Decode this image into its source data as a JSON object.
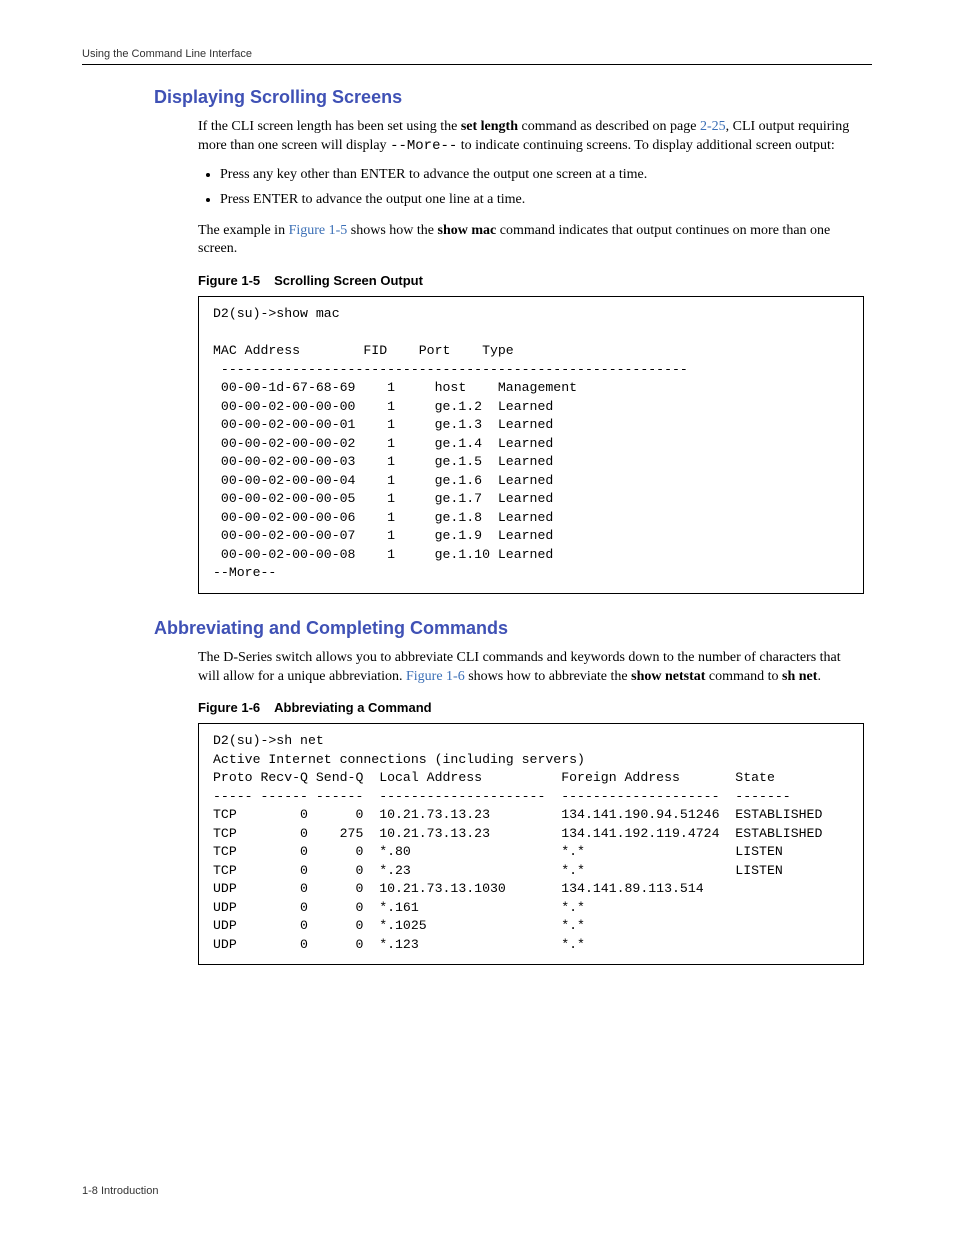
{
  "running_head": "Using the Command Line Interface",
  "footer": "1-8   Introduction",
  "section1": {
    "title": "Displaying Scrolling Screens",
    "para1_pre": "If the CLI screen length has been set using the ",
    "set_length": "set length",
    "para1_mid": " command as described on page ",
    "xref1": "2-25",
    "para1_post": ", CLI output requiring more than one screen will display ",
    "more_inline": "--More--",
    "para1_tail": " to indicate continuing screens. To display additional screen output:",
    "bullets": [
      "Press any key other than ENTER to advance the output one screen at a time.",
      "Press ENTER to advance the output one line at a time."
    ],
    "para2_pre": "The example in ",
    "xref2": "Figure 1-5",
    "para2_mid": " shows how the ",
    "show_mac": "show mac",
    "para2_post": " command indicates that output continues on more than one screen.",
    "figcap": {
      "label": "Figure 1-5",
      "title": "Scrolling Screen Output"
    },
    "cli": {
      "prompt": "D2(su)->show mac",
      "header": "MAC Address        FID    Port    Type",
      "rule": " -----------------------------------------------------------",
      "rows": [
        " 00-00-1d-67-68-69    1     host    Management",
        " 00-00-02-00-00-00    1     ge.1.2  Learned",
        " 00-00-02-00-00-01    1     ge.1.3  Learned",
        " 00-00-02-00-00-02    1     ge.1.4  Learned",
        " 00-00-02-00-00-03    1     ge.1.5  Learned",
        " 00-00-02-00-00-04    1     ge.1.6  Learned",
        " 00-00-02-00-00-05    1     ge.1.7  Learned",
        " 00-00-02-00-00-06    1     ge.1.8  Learned",
        " 00-00-02-00-00-07    1     ge.1.9  Learned",
        " 00-00-02-00-00-08    1     ge.1.10 Learned"
      ],
      "more": "--More--"
    }
  },
  "section2": {
    "title": "Abbreviating and Completing Commands",
    "para1_pre": "The D-Series switch allows you to abbreviate CLI commands and keywords down to the number of characters that will allow for a unique abbreviation. ",
    "xref1": "Figure 1-6",
    "para1_mid": " shows how to abbreviate the ",
    "show_netstat": "show netstat",
    "para1_mid2": " command to ",
    "sh_net": "sh net",
    "para1_post": ".",
    "figcap": {
      "label": "Figure 1-6",
      "title": "Abbreviating a Command"
    },
    "cli": {
      "prompt": "D2(su)->sh net",
      "title_line": "Active Internet connections (including servers)",
      "header": "Proto Recv-Q Send-Q  Local Address          Foreign Address       State",
      "rule": "----- ------ ------  ---------------------  --------------------  -------",
      "rows": [
        "TCP        0      0  10.21.73.13.23         134.141.190.94.51246  ESTABLISHED",
        "TCP        0    275  10.21.73.13.23         134.141.192.119.4724  ESTABLISHED",
        "TCP        0      0  *.80                   *.*                   LISTEN",
        "TCP        0      0  *.23                   *.*                   LISTEN",
        "UDP        0      0  10.21.73.13.1030       134.141.89.113.514",
        "UDP        0      0  *.161                  *.*",
        "UDP        0      0  *.1025                 *.*",
        "UDP        0      0  *.123                  *.*"
      ]
    }
  }
}
